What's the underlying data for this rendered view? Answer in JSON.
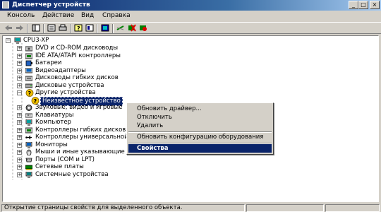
{
  "window": {
    "title": "Диспетчер устройств"
  },
  "menu": [
    "Консоль",
    "Действие",
    "Вид",
    "Справка"
  ],
  "toolbar_icons": [
    "back-icon",
    "forward-icon",
    "console-tree-icon",
    "properties-icon",
    "print-icon",
    "help-icon",
    "view-icon",
    "update-driver-icon",
    "scan-hardware-icon",
    "uninstall-icon",
    "disable-icon"
  ],
  "tree": {
    "root": "CPU3-XP",
    "items": [
      {
        "label": "DVD и CD-ROM дисководы",
        "icon": "cdrom-icon"
      },
      {
        "label": "IDE ATA/ATAPI контроллеры",
        "icon": "ide-icon"
      },
      {
        "label": "Батареи",
        "icon": "battery-icon"
      },
      {
        "label": "Видеоадаптеры",
        "icon": "display-adapter-icon"
      },
      {
        "label": "Дисководы гибких дисков",
        "icon": "floppy-icon"
      },
      {
        "label": "Дисковые устройства",
        "icon": "disk-icon"
      },
      {
        "label": "Другие устройства",
        "icon": "unknown-device-icon"
      },
      {
        "label": "Неизвестное устройство",
        "icon": "unknown-device-icon"
      },
      {
        "label": "Звуковые, видео и игровые",
        "icon": "sound-icon"
      },
      {
        "label": "Клавиатуры",
        "icon": "keyboard-icon"
      },
      {
        "label": "Компьютер",
        "icon": "computer-icon"
      },
      {
        "label": "Контроллеры гибких дисков",
        "icon": "floppy-controller-icon"
      },
      {
        "label": "Контроллеры универсальной",
        "icon": "usb-icon"
      },
      {
        "label": "Мониторы",
        "icon": "monitor-icon"
      },
      {
        "label": "Мыши и иные указывающие устройства",
        "icon": "mouse-icon"
      },
      {
        "label": "Порты (COM и LPT)",
        "icon": "port-icon"
      },
      {
        "label": "Сетевые платы",
        "icon": "network-icon"
      },
      {
        "label": "Системные устройства",
        "icon": "system-icon"
      }
    ]
  },
  "context_menu": [
    {
      "label": "Обновить драйвер..."
    },
    {
      "label": "Отключить"
    },
    {
      "label": "Удалить"
    },
    {
      "label": "Обновить конфигурацию оборудования"
    },
    {
      "label": "Свойства",
      "active": true
    }
  ],
  "status": {
    "text": "Открытие страницы свойств для выделенного объекта."
  },
  "colors": {
    "title_active": "#0a246a",
    "face": "#d4d0c8",
    "selection": "#0a246a"
  }
}
